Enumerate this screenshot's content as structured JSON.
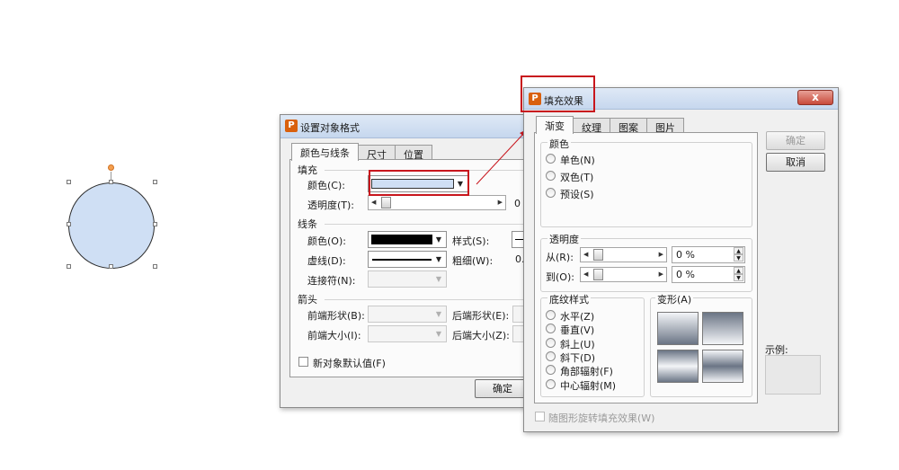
{
  "format_dialog": {
    "title": "设置对象格式",
    "tabs": [
      "颜色与线条",
      "尺寸",
      "位置"
    ],
    "fill_section": "填充",
    "fill_color_label": "颜色(C):",
    "transparency_label": "透明度(T):",
    "transparency_value": "0",
    "line_section": "线条",
    "line_color_label": "颜色(O):",
    "dash_label": "虚线(D):",
    "connector_label": "连接符(N):",
    "style_label": "样式(S):",
    "weight_label": "粗细(W):",
    "weight_value": "0.",
    "arrow_section": "箭头",
    "begin_style_label": "前端形状(B):",
    "end_style_label": "后端形状(E):",
    "begin_size_label": "前端大小(I):",
    "end_size_label": "后端大小(Z):",
    "default_checkbox": "新对象默认值(F)",
    "ok_label": "确定"
  },
  "fill_dialog": {
    "title": "填充效果",
    "close_label": "x",
    "tabs": [
      "渐变",
      "纹理",
      "图案",
      "图片"
    ],
    "colors_group": "颜色",
    "color_options": [
      "单色(N)",
      "双色(T)",
      "预设(S)"
    ],
    "transparency_group": "透明度",
    "from_label": "从(R):",
    "to_label": "到(O):",
    "from_value": "0 %",
    "to_value": "0 %",
    "shading_group": "底纹样式",
    "shading_options": [
      "水平(Z)",
      "垂直(V)",
      "斜上(U)",
      "斜下(D)",
      "角部辐射(F)",
      "中心辐射(M)"
    ],
    "variants_group": "变形(A)",
    "ok_label": "确定",
    "cancel_label": "取消",
    "sample_label": "示例:",
    "rotate_checkbox": "随图形旋转填充效果(W)"
  },
  "colors": {
    "fill_color": "#cfdff4",
    "line_color": "#000000",
    "highlight": "#c8161d",
    "accent_icon": "#d9600e"
  },
  "icons": [
    "app-logo-icon",
    "close-icon",
    "dropdown-arrow-icon",
    "slider-left-arrow-icon",
    "slider-right-arrow-icon",
    "spin-up-icon",
    "spin-down-icon"
  ]
}
